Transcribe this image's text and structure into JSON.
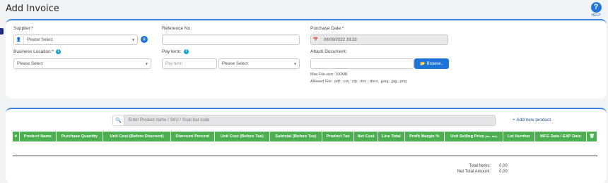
{
  "page": {
    "title": "Add Invoice"
  },
  "help": {
    "label": "HELP",
    "icon": "?"
  },
  "form": {
    "supplier": {
      "label": "Supplier:*",
      "value": "Please Select"
    },
    "reference": {
      "label": "Reference No:",
      "value": ""
    },
    "purchase_date": {
      "label": "Purchase Date:*",
      "value": "06/09/2022 19:33"
    },
    "business_location": {
      "label": "Business Location:*",
      "value": "Please Select"
    },
    "pay_term": {
      "label": "Pay term:",
      "placeholder": "Pay term",
      "select_value": "Please Select"
    },
    "attach": {
      "label": "Attach Document:",
      "browse_label": "Browse..",
      "max_size": "Max File size: 100MB",
      "allowed": "Allowed File: .pdf, .csv, .zip, .doc, .docx, .jpeg, .jpg, .png"
    }
  },
  "products": {
    "search_placeholder": "Enter Product name / SKU / Scan bar code",
    "add_new_label": "Add new product",
    "columns": {
      "hash": "#",
      "product_name": "Product Name",
      "purchase_qty": "Purchase Quantity",
      "unit_cost_before_discount": "Unit Cost (Before Discount)",
      "discount_percent": "Discount Percent",
      "unit_cost_before_tax": "Unit Cost (Before Tax)",
      "subtotal_before_tax": "Subtotal (Before Tax)",
      "product_tax": "Product Tax",
      "net_cost": "Net Cost",
      "line_total": "Line Total",
      "profit_margin": "Profit Margin %",
      "unit_selling_price": "Unit Selling Price",
      "unit_selling_price_note": "(Inc. tax)",
      "lot_number": "Lot Number",
      "mfg_exp": "MFG Date / EXP Date"
    }
  },
  "totals": {
    "total_items_label": "Total Items:",
    "total_items_value": "0.00",
    "net_total_label": "Net Total Amount:",
    "net_total_value": "0.00"
  },
  "colors": {
    "accent": "#1e74d8",
    "table_header": "#4caf50"
  }
}
